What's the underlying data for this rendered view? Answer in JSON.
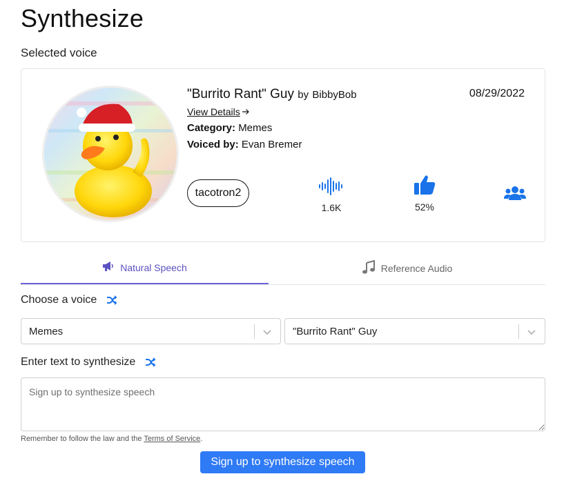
{
  "page": {
    "title": "Synthesize",
    "selected_voice_label": "Selected voice"
  },
  "voice": {
    "name": "\"Burrito Rant\" Guy",
    "by_prefix": "by",
    "author": "BibbyBob",
    "date": "08/29/2022",
    "view_details": "View Details",
    "category_label": "Category:",
    "category": "Memes",
    "voiced_by_label": "Voiced by:",
    "voiced_by": "Evan Bremer",
    "model": "tacotron2",
    "uses": "1.6K",
    "rating": "52%",
    "avatar_icon": "rubber-duck-santa-hat"
  },
  "tabs": {
    "natural": "Natural Speech",
    "reference": "Reference Audio"
  },
  "form": {
    "choose_voice_label": "Choose a voice",
    "category_select_value": "Memes",
    "voice_select_value": "\"Burrito Rant\" Guy",
    "enter_text_label": "Enter text to synthesize",
    "textarea_placeholder": "Sign up to synthesize speech",
    "notice_prefix": "Remember to follow the law and the",
    "notice_link": "Terms of Service",
    "notice_suffix": ".",
    "submit_label": "Sign up to synthesize speech"
  },
  "colors": {
    "accent_blue": "#2f7af5",
    "tab_active": "#5b52c2",
    "icon_blue": "#1a73e8"
  }
}
